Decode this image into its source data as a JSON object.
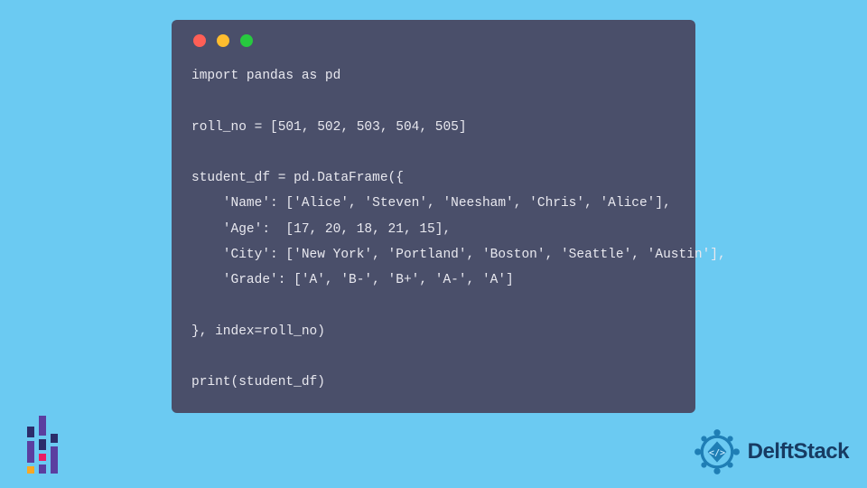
{
  "code": {
    "lines": [
      "import pandas as pd",
      "",
      "roll_no = [501, 502, 503, 504, 505]",
      "",
      "student_df = pd.DataFrame({",
      "    'Name': ['Alice', 'Steven', 'Neesham', 'Chris', 'Alice'],",
      "    'Age':  [17, 20, 18, 21, 15],",
      "    'City': ['New York', 'Portland', 'Boston', 'Seattle', 'Austin'],",
      "    'Grade': ['A', 'B-', 'B+', 'A-', 'A']",
      "",
      "}, index=roll_no)",
      "",
      "print(student_df)"
    ]
  },
  "brand": {
    "name": "DelftStack"
  },
  "colors": {
    "background": "#6bcaf2",
    "window": "#4a4f6a",
    "code_text": "#e8e8ef",
    "brand_text": "#173b62",
    "badge": "#1f7eb5"
  }
}
